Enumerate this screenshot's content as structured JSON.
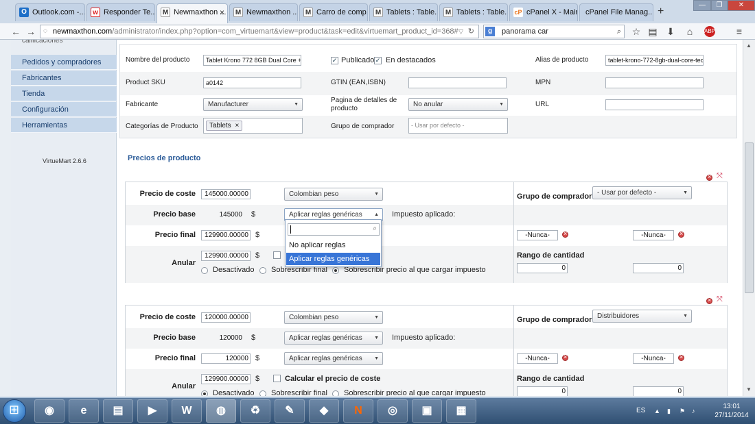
{
  "browser": {
    "tabs": [
      {
        "label": "Outlook.com -...",
        "fav": "O",
        "color": "#1e6fc8"
      },
      {
        "label": "Responder Te...",
        "fav": "w",
        "color": "#d22"
      },
      {
        "label": "Newmaxthon ...",
        "fav": "M",
        "color": "#333",
        "active": true
      },
      {
        "label": "Newmaxthon ...",
        "fav": "M",
        "color": "#333"
      },
      {
        "label": "Carro de comp...",
        "fav": "M",
        "color": "#333"
      },
      {
        "label": "Tablets : Table...",
        "fav": "M",
        "color": "#333"
      },
      {
        "label": "Tablets : Table...",
        "fav": "M",
        "color": "#333"
      },
      {
        "label": "cPanel X - Main",
        "fav": "cP",
        "color": "#e8731c"
      },
      {
        "label": "cPanel File Manag...",
        "fav": "",
        "color": "#cfdbe9"
      }
    ],
    "new_tab": "+",
    "url_host": "newmaxthon.com",
    "url_path": "/administrator/index.php?option=com_virtuemart&view=product&task=edit&virtuemart_product_id=368#",
    "search_value": "panorama car",
    "search_engine_glyph": "g"
  },
  "sidebar": {
    "top_partial": "calificaciones",
    "items": [
      "Pedidos y compradores",
      "Fabricantes",
      "Tienda",
      "Configuración",
      "Herramientas"
    ],
    "version": "VirtueMart 2.6.6"
  },
  "product_info": {
    "nombre_label": "Nombre del producto",
    "nombre_value": "Tablet Krono 772 8GB Dual Core + T",
    "publicado_label": "Publicado",
    "destacados_label": "En destacados",
    "alias_label": "Alias de producto",
    "alias_value": "tablet-krono-772-8gb-dual-core-teclac",
    "sku_label": "Product SKU",
    "sku_value": "a0142",
    "gtin_label": "GTIN (EAN,ISBN)",
    "mpn_label": "MPN",
    "fabricante_label": "Fabricante",
    "fabricante_value": "Manufacturer",
    "pagina_label": "Pagina de detalles de producto",
    "pagina_value": "No anular",
    "url_label": "URL",
    "categorias_label": "Categorías de Producto",
    "categoria_tag": "Tablets",
    "grupo_label": "Grupo de comprador",
    "grupo_placeholder": "- Usar por defecto -"
  },
  "pricing": {
    "section_title": "Precios de producto",
    "block1": {
      "precio_coste_label": "Precio de coste",
      "precio_coste_value": "145000.00000",
      "currency": "Colombian peso",
      "grupo_label": "Grupo de comprador",
      "grupo_value": "- Usar por defecto -",
      "precio_base_label": "Precio base",
      "precio_base_value": "145000",
      "currency_symbol": "$",
      "rule_select": "Aplicar reglas genéricas",
      "impuesto_label": "Impuesto aplicado:",
      "precio_final_label": "Precio final",
      "precio_final_value": "129900.00000",
      "nunca_1": "-Nunca-",
      "nunca_2": "-Nunca-",
      "anular_label": "Anular",
      "anular_value": "129900.00000",
      "rango_label": "Rango de cantidad",
      "rango_min": "0",
      "rango_max": "0",
      "radio_desactivado": "Desactivado",
      "radio_sobrescribir_final": "Sobrescribir final",
      "radio_sobrescribir_precio": "Sobrescribir precio al que cargar impuesto",
      "dropdown_options": [
        "No aplicar reglas",
        "Aplicar reglas genéricas"
      ]
    },
    "block2": {
      "precio_coste_label": "Precio de coste",
      "precio_coste_value": "120000.00000",
      "currency": "Colombian peso",
      "grupo_label": "Grupo de comprador",
      "grupo_value": "Distribuidores",
      "precio_base_label": "Precio base",
      "precio_base_value": "120000",
      "currency_symbol": "$",
      "rule_select_base": "Aplicar reglas genéricas",
      "impuesto_label": "Impuesto aplicado:",
      "precio_final_label": "Precio final",
      "precio_final_value": "120000",
      "rule_select_final": "Aplicar reglas genéricas",
      "nunca_1": "-Nunca-",
      "nunca_2": "-Nunca-",
      "anular_label": "Anular",
      "anular_value": "129900.00000",
      "calcular_label": "Calcular el precio de coste",
      "rango_label": "Rango de cantidad",
      "rango_min": "0",
      "rango_max": "0",
      "radio_desactivado": "Desactivado",
      "radio_sobrescribir_final": "Sobrescribir final",
      "radio_sobrescribir_precio": "Sobrescribir precio al que cargar impuesto"
    }
  },
  "taskbar": {
    "apps": [
      "◉",
      "e",
      "▤",
      "▶",
      "W",
      "◍",
      "♻",
      "✎",
      "◆",
      "N",
      "◎",
      "▣",
      "▦"
    ],
    "lang": "ES",
    "time": "13:01",
    "date": "27/11/2014"
  }
}
